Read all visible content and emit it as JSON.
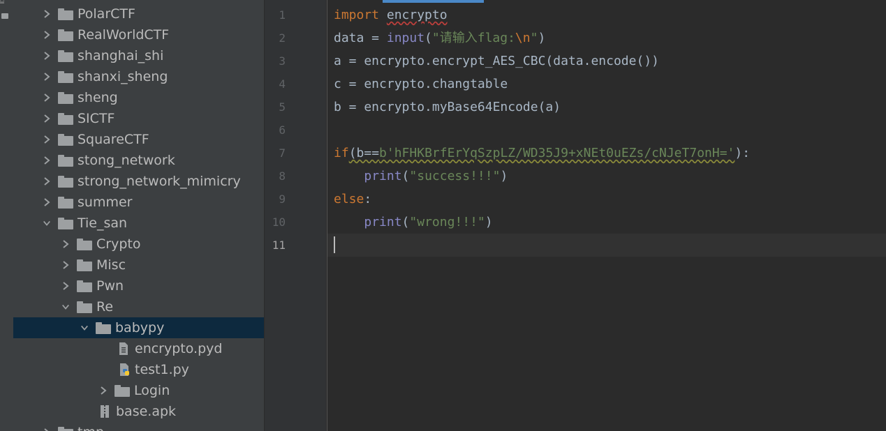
{
  "tree": {
    "items": [
      {
        "label": "PolarCTF",
        "type": "folder",
        "expanded": false
      },
      {
        "label": "RealWorldCTF",
        "type": "folder",
        "expanded": false
      },
      {
        "label": "shanghai_shi",
        "type": "folder",
        "expanded": false
      },
      {
        "label": "shanxi_sheng",
        "type": "folder",
        "expanded": false
      },
      {
        "label": "sheng",
        "type": "folder",
        "expanded": false
      },
      {
        "label": "SICTF",
        "type": "folder",
        "expanded": false
      },
      {
        "label": "SquareCTF",
        "type": "folder",
        "expanded": false
      },
      {
        "label": "stong_network",
        "type": "folder",
        "expanded": false
      },
      {
        "label": "strong_network_mimicry",
        "type": "folder",
        "expanded": false
      },
      {
        "label": "summer",
        "type": "folder",
        "expanded": false
      },
      {
        "label": "Tie_san",
        "type": "folder",
        "expanded": true
      },
      {
        "label": "Crypto",
        "type": "folder",
        "expanded": false
      },
      {
        "label": "Misc",
        "type": "folder",
        "expanded": false
      },
      {
        "label": "Pwn",
        "type": "folder",
        "expanded": false
      },
      {
        "label": "Re",
        "type": "folder",
        "expanded": true
      },
      {
        "label": "babypy",
        "type": "folder",
        "expanded": true,
        "selected": true
      },
      {
        "label": "encrypto.pyd",
        "type": "file-pyd"
      },
      {
        "label": "test1.py",
        "type": "file-py"
      },
      {
        "label": "Login",
        "type": "folder",
        "expanded": false
      },
      {
        "label": "base.apk",
        "type": "file-apk"
      },
      {
        "label": "tmp",
        "type": "folder",
        "expanded": false
      }
    ]
  },
  "editor": {
    "line_numbers": [
      "1",
      "2",
      "3",
      "4",
      "5",
      "6",
      "7",
      "8",
      "9",
      "10",
      "11"
    ],
    "current_line": "11",
    "code": {
      "l1_kw": "import",
      "l1_mod": "encrypto",
      "l2_a": "data = ",
      "l2_fn": "input",
      "l2_open": "(",
      "l2_str": "\"请输入flag:",
      "l2_esc": "\\n",
      "l2_strend": "\"",
      "l2_close": ")",
      "l3": "a = encrypto.encrypt_AES_CBC(data.encode())",
      "l4": "c = encrypto.changtable",
      "l5": "b = encrypto.myBase64Encode(a)",
      "l7_kw": "if",
      "l7_cond": "(b==",
      "l7_bytes": "b'hFHKBrfErYqSzpLZ/WD35J9+xNEt0uEZs/cNJeT7onH='",
      "l7_end": "):",
      "l8_fn": "print",
      "l8_open": "(",
      "l8_str": "\"success!!!\"",
      "l8_close": ")",
      "l9_kw": "else",
      "l9_colon": ":",
      "l10_fn": "print",
      "l10_open": "(",
      "l10_str": "\"wrong!!!\"",
      "l10_close": ")"
    }
  },
  "colors": {
    "keyword": "#cc7832",
    "builtin": "#8888c6",
    "string": "#6a8759",
    "text": "#a9b7c6",
    "selection": "#0d293e"
  }
}
